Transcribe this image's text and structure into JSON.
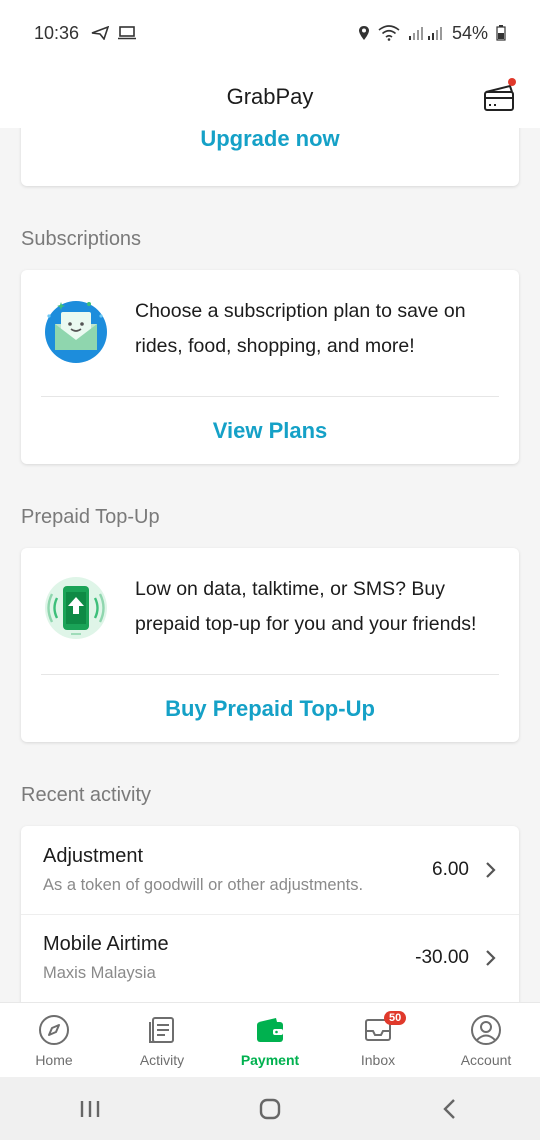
{
  "status_bar": {
    "time": "10:36",
    "battery": "54%"
  },
  "header": {
    "title": "GrabPay"
  },
  "upgrade_card": {
    "link": "Upgrade now"
  },
  "subscriptions": {
    "section_title": "Subscriptions",
    "description": "Choose a subscription plan to save on rides, food, shopping, and more!",
    "link": "View Plans"
  },
  "prepaid": {
    "section_title": "Prepaid Top-Up",
    "description": "Low on data, talktime, or SMS? Buy prepaid top-up for you and your friends!",
    "link": "Buy Prepaid Top-Up"
  },
  "recent_activity": {
    "section_title": "Recent activity",
    "items": [
      {
        "title": "Adjustment",
        "subtitle": "As a token of goodwill or other adjustments.",
        "amount": "6.00"
      },
      {
        "title": "Mobile Airtime",
        "subtitle": "Maxis Malaysia",
        "amount": "-30.00"
      }
    ]
  },
  "bottom_nav": {
    "items": [
      {
        "label": "Home",
        "icon": "compass-icon"
      },
      {
        "label": "Activity",
        "icon": "document-icon"
      },
      {
        "label": "Payment",
        "icon": "wallet-icon"
      },
      {
        "label": "Inbox",
        "icon": "inbox-icon",
        "badge": "50"
      },
      {
        "label": "Account",
        "icon": "user-icon"
      }
    ],
    "active": "Payment"
  },
  "colors": {
    "accent_blue": "#15a1c7",
    "brand_green": "#00b14f",
    "badge_red": "#e0392b"
  }
}
